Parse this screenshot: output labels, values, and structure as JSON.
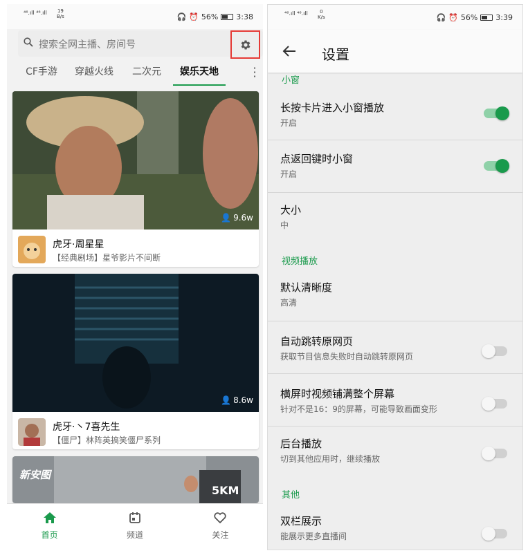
{
  "left": {
    "status": {
      "signal": "⁴⁶.ıll ⁴⁶.ıll",
      "speed_value": "19",
      "speed_unit": "B/s",
      "battery": "56%",
      "time": "3:38"
    },
    "search": {
      "placeholder": "搜索全网主播、房间号"
    },
    "tabs": [
      {
        "label": "CF手游"
      },
      {
        "label": "穿越火线"
      },
      {
        "label": "二次元"
      },
      {
        "label": "娱乐天地"
      }
    ],
    "cards": [
      {
        "viewers": "9.6w",
        "name": "虎牙·周星星",
        "desc": "【经典剧场】星爷影片不间断"
      },
      {
        "viewers": "8.6w",
        "name": "虎牙·丶7喜先生",
        "desc": "【僵尸】林阵英搞笑僵尸系列"
      },
      {
        "overlay_text": "5KM",
        "logo_text": "新安图"
      }
    ],
    "bottom_nav": [
      {
        "label": "首页",
        "icon": "home-icon"
      },
      {
        "label": "频道",
        "icon": "channel-icon"
      },
      {
        "label": "关注",
        "icon": "heart-icon"
      }
    ]
  },
  "right": {
    "status": {
      "signal": "⁴⁶.ıll ⁴⁶.ıll",
      "speed_value": "0",
      "speed_unit": "K/s",
      "battery": "56%",
      "time": "3:39"
    },
    "title": "设置",
    "sections": {
      "small_window": "小窗",
      "video_playback": "视频播放",
      "other": "其他"
    },
    "rows": [
      {
        "title": "长按卡片进入小窗播放",
        "sub": "开启",
        "toggle": true
      },
      {
        "title": "点返回键时小窗",
        "sub": "开启",
        "toggle": true
      },
      {
        "title": "大小",
        "sub": "中"
      },
      {
        "title": "默认清晰度",
        "sub": "高清"
      },
      {
        "title": "自动跳转原网页",
        "sub": "获取节目信息失败时自动跳转原网页",
        "toggle": false
      },
      {
        "title": "横屏时视频铺满整个屏幕",
        "sub": "针对不是16：9的屏幕，可能导致画面变形",
        "toggle": false
      },
      {
        "title": "后台播放",
        "sub": "切到其他应用时，继续播放",
        "toggle": false
      },
      {
        "title": "双栏展示",
        "sub": "能展示更多直播间",
        "toggle": false
      }
    ]
  },
  "colors": {
    "accent": "#1a9a4c",
    "highlight": "#e53935"
  }
}
